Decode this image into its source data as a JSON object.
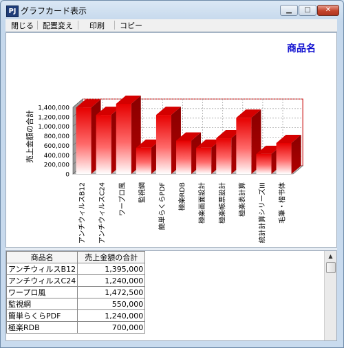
{
  "window": {
    "app_icon": "PJ",
    "title": "グラフカード表示",
    "buttons": {
      "minimize": "▁",
      "maximize": "□",
      "close": "✕"
    }
  },
  "menu": {
    "items": [
      {
        "label": "閉じる"
      },
      {
        "label": "配置変え"
      },
      {
        "label": "印刷"
      },
      {
        "label": "コピー"
      }
    ]
  },
  "chart_data": {
    "type": "bar",
    "title": "商品名",
    "ylabel": "売上金額の合計",
    "xlabel": "",
    "ylim": [
      0,
      1400000
    ],
    "yticks": [
      "1,400,000",
      "1,200,000",
      "1,000,000",
      "800,000",
      "600,000",
      "400,000",
      "200,000",
      "0"
    ],
    "categories": [
      "アンチウィルスB12",
      "アンチウィルスC24",
      "ワープロ風",
      "監視網",
      "簡単らくらPDF",
      "極楽RDB",
      "極楽画面設計",
      "極楽帳票設計",
      "極楽表計算",
      "統計計算シリーズIII",
      "毛筆・楷书体"
    ],
    "values": [
      1395000,
      1240000,
      1472500,
      550000,
      1240000,
      700000,
      550000,
      750000,
      1180000,
      420000,
      650000
    ]
  },
  "grid": {
    "headers": [
      "商品名",
      "売上金額の合計"
    ],
    "rows": [
      [
        "アンチウィルスB12",
        "1,395,000"
      ],
      [
        "アンチウィルスC24",
        "1,240,000"
      ],
      [
        "ワープロ風",
        "1,472,500"
      ],
      [
        "監視網",
        "550,000"
      ],
      [
        "簡単らくらPDF",
        "1,240,000"
      ],
      [
        "極楽RDB",
        "700,000"
      ]
    ],
    "scroll_up": "▲"
  }
}
